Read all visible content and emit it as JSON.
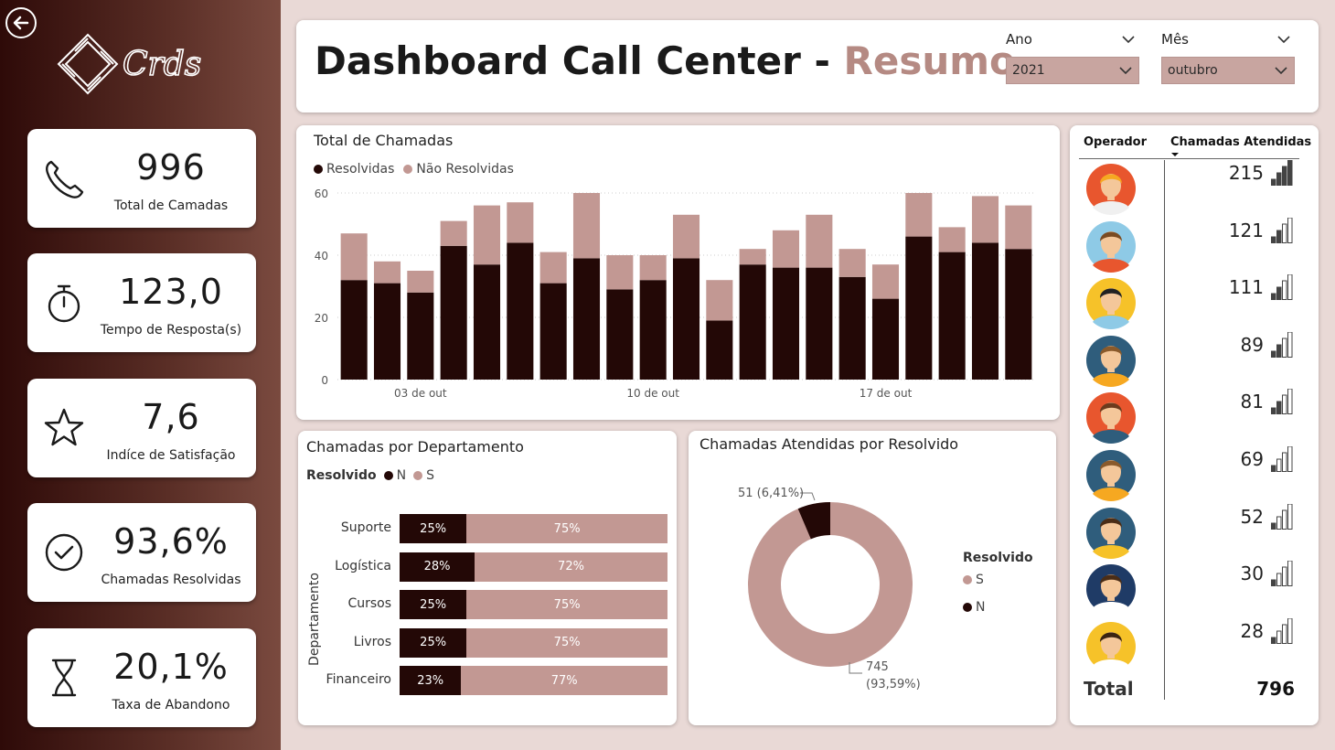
{
  "header": {
    "title_main": "Dashboard Call Center",
    "title_sep": "-",
    "title_accent": "Resumo",
    "filters": [
      {
        "label": "Ano",
        "value": "2021"
      },
      {
        "label": "Mês",
        "value": "outubro"
      }
    ]
  },
  "brand": {
    "logo_text": "Crds"
  },
  "kpis": [
    {
      "value": "996",
      "label": "Total de Camadas",
      "icon": "phone-icon"
    },
    {
      "value": "123,0",
      "label": "Tempo de Resposta(s)",
      "icon": "stopwatch-icon"
    },
    {
      "value": "7,6",
      "label": "Indíce de Satisfação",
      "icon": "star-icon"
    },
    {
      "value": "93,6%",
      "label": "Chamadas Resolvidas",
      "icon": "check-circle-icon"
    },
    {
      "value": "20,1%",
      "label": "Taxa de Abandono",
      "icon": "hourglass-icon"
    }
  ],
  "colors": {
    "dark": "#230806",
    "light": "#c29893",
    "accent": "#b58a83"
  },
  "chart_data": [
    {
      "type": "bar",
      "title": "Total de Chamadas",
      "stacked": true,
      "x_tick_labels": [
        "03 de out",
        "10 de out",
        "17 de out"
      ],
      "y_ticks": [
        0,
        20,
        40,
        60
      ],
      "ylim": [
        0,
        60
      ],
      "grid": true,
      "legend_position": "top-left",
      "series": [
        {
          "name": "Resolvidas",
          "values": [
            32,
            31,
            28,
            43,
            37,
            44,
            31,
            39,
            29,
            32,
            39,
            19,
            37,
            36,
            36,
            33,
            26,
            46,
            41,
            44,
            42
          ]
        },
        {
          "name": "Não Resolvidas",
          "values": [
            15,
            7,
            7,
            8,
            19,
            13,
            10,
            21,
            11,
            8,
            14,
            13,
            5,
            12,
            17,
            9,
            11,
            14,
            8,
            15,
            14
          ]
        }
      ]
    },
    {
      "type": "bar",
      "orientation": "horizontal",
      "stacked_percent": true,
      "title": "Chamadas por Departamento",
      "legend_title": "Resolvido",
      "legend_position": "top-left",
      "ylabel": "Departamento",
      "categories": [
        "Suporte",
        "Logística",
        "Cursos",
        "Livros",
        "Financeiro"
      ],
      "series": [
        {
          "name": "N",
          "values": [
            25,
            28,
            25,
            25,
            23
          ],
          "labels": [
            "25%",
            "28%",
            "25%",
            "25%",
            "23%"
          ]
        },
        {
          "name": "S",
          "values": [
            75,
            72,
            75,
            75,
            77
          ],
          "labels": [
            "75%",
            "72%",
            "75%",
            "75%",
            "77%"
          ]
        }
      ]
    },
    {
      "type": "pie",
      "donut": true,
      "title": "Chamadas Atendidas por Resolvido",
      "legend_title": "Resolvido",
      "legend_position": "right",
      "slices": [
        {
          "name": "S",
          "value": 745,
          "label_value": "745",
          "label_pct": "(93,59%)"
        },
        {
          "name": "N",
          "value": 51,
          "label_value": "51 (6,41%)"
        }
      ]
    },
    {
      "type": "table",
      "columns": [
        "Operador",
        "Chamadas Atendidas"
      ],
      "sort": "Chamadas Atendidas desc",
      "rows": [
        {
          "avatar": "avatar-headset-woman-icon",
          "value": 215
        },
        {
          "avatar": "avatar-man-blue-icon",
          "value": 121
        },
        {
          "avatar": "avatar-man-yellow-icon",
          "value": 111
        },
        {
          "avatar": "avatar-man-glasses-icon",
          "value": 89
        },
        {
          "avatar": "avatar-man-beard-icon",
          "value": 81
        },
        {
          "avatar": "avatar-woman-teal-icon",
          "value": 69
        },
        {
          "avatar": "avatar-woman-green-icon",
          "value": 52
        },
        {
          "avatar": "avatar-doctor-icon",
          "value": 30
        },
        {
          "avatar": "avatar-woman-yellow-icon",
          "value": 28
        }
      ],
      "total_label": "Total",
      "total_value": "796"
    }
  ]
}
